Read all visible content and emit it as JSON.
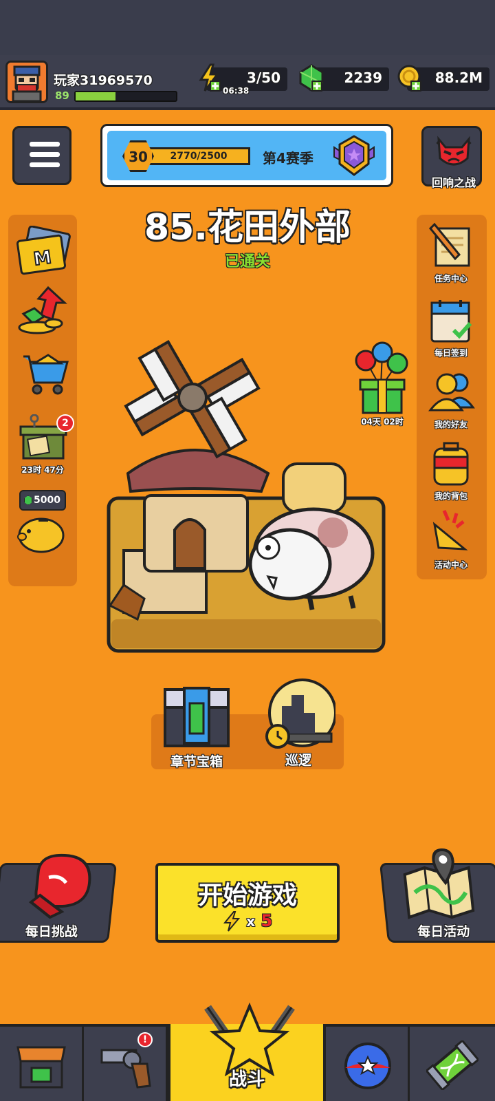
{
  "player": {
    "name": "玩家31969570",
    "level": "89",
    "xp_fraction": 0.4
  },
  "resources": {
    "energy": "3/50",
    "energy_timer": "06:38",
    "gems": "2239",
    "coins": "88.2M"
  },
  "season": {
    "level": "30",
    "xp": "2770/2500",
    "label": "第4赛季"
  },
  "echo_battle": {
    "label": "回响之战"
  },
  "stage": {
    "title": "85.花田外部",
    "status": "已通关"
  },
  "left_rail": {
    "supply_timer": "23时 47分",
    "supply_badge": "2",
    "piggy_gems": "5000"
  },
  "right_rail": {
    "tasks": "任务中心",
    "checkin": "每日签到",
    "friends": "我的好友",
    "backpack": "我的背包",
    "events": "活动中心"
  },
  "gift": {
    "timer": "04天 02时"
  },
  "chapter_chest": {
    "label": "章节宝箱"
  },
  "patrol": {
    "label": "巡逻"
  },
  "daily_challenge": {
    "label": "每日挑战"
  },
  "daily_activity": {
    "label": "每日活动"
  },
  "start": {
    "label": "开始游戏",
    "cost_x": "x",
    "cost_n": "5"
  },
  "nav": {
    "battle": "战斗"
  },
  "colors": {
    "bg": "#f7941d",
    "bar": "#3d3f4e",
    "start": "#fbe12a",
    "green": "#8ae030"
  }
}
